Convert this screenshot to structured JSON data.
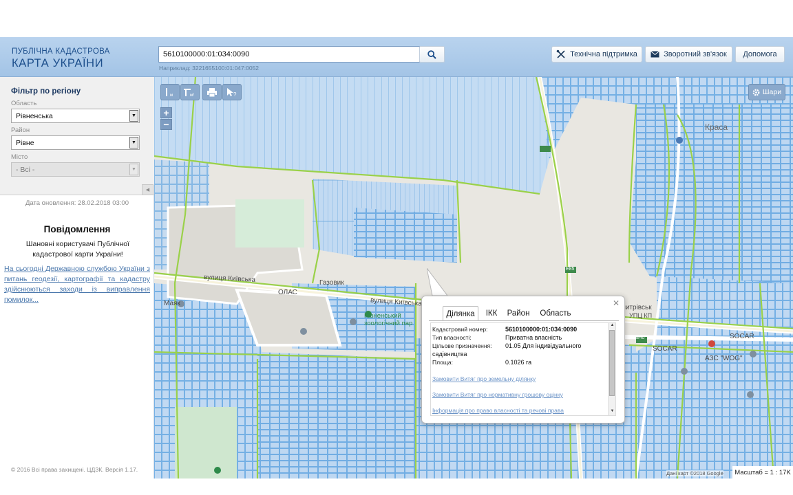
{
  "header": {
    "logo_line1": "ПУБЛІЧНА КАДАСТРОВА",
    "logo_line2": "КАРТА УКРАЇНИ",
    "search_value": "5610100000:01:034:0090",
    "search_hint": "Наприклад: 3221655100:01:047:0052",
    "support_label": "Технічна підтримка",
    "feedback_label": "Зворотний зв'язок",
    "help_label": "Допомога"
  },
  "sidebar": {
    "filter_title": "Фільтр по регіону",
    "oblast_label": "Область",
    "oblast_value": "Рівненська",
    "rayon_label": "Район",
    "rayon_value": "Рівне",
    "misto_label": "Місто",
    "misto_value": "- Всі -",
    "update_date": "Дата оновлення: 28.02.2018 03:00",
    "notice_title": "Повідомлення",
    "notice_text": "Шановні користувачі Публічної кадастрової карти України!",
    "notice_link": "На сьогодні Державною службою України з питань геодезії, картографії та кадастру здійснюються заходи із виправлення помилок...",
    "copyright": "© 2016 Всі права захищені. ЦДЗК. Версія 1.17."
  },
  "map": {
    "layers_label": "Шари",
    "scale": "Масштаб = 1 : 17K",
    "attribution": "Дані карт ©2018 Google",
    "labels": {
      "street1": "вулиця Київська",
      "street2": "вулиця Київська",
      "gazovik": "Газовик",
      "olas": "ОЛАС",
      "mayak": "Маяк",
      "zoo": "Рівненський зоологічний пар",
      "svyato": "Свято-Дмитрівськ",
      "upts": "УПЦ КП",
      "socar1": "SOCAR",
      "socar2": "SOCAR",
      "azs": "АЗС \"WOG\"",
      "e40": "E40",
      "e85": "E85",
      "krasa": "Краса",
      "kyiv_road": "Київська"
    }
  },
  "popup": {
    "tabs": [
      "Ділянка",
      "ІКК",
      "Район",
      "Область"
    ],
    "active_tab": "Ділянка",
    "cadastral_label": "Кадастровий номер:",
    "cadastral_value": "5610100000:01:034:0090",
    "ownership_label": "Тип власності:",
    "ownership_value": "Приватна власність",
    "purpose_label": "Цільове призначення:",
    "purpose_value_line1": "01.05 Для індивідуального",
    "purpose_value_line2": "садівництва",
    "area_label": "Площа:",
    "area_value": "0.1026 га",
    "link1": "Замовити Витяг про земельну ділянку",
    "link2": "Замовити Витяг про нормативну грошову оцінку",
    "link3": "Інформація про право власності та речові права"
  },
  "colors": {
    "header_bg": "#a3c4e6",
    "parcel_fill": "#b7d3f0",
    "parcel_stroke": "#5ea3e0",
    "boundary_green": "#9ad149",
    "link_blue": "#4b78ad"
  }
}
